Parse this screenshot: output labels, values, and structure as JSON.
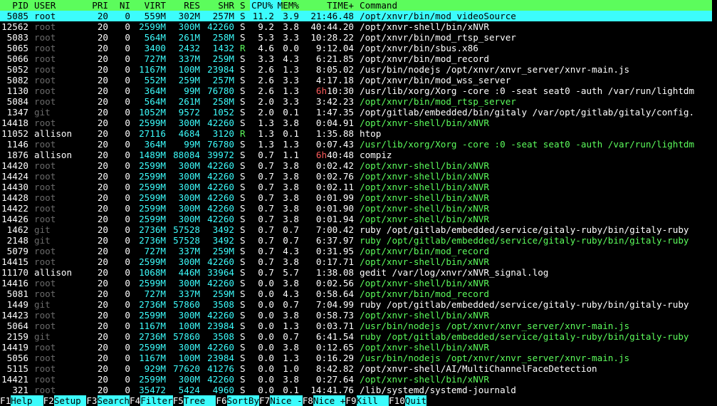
{
  "header": {
    "pid": "PID",
    "user": "USER",
    "pri": "PRI",
    "ni": "NI",
    "virt": "VIRT",
    "res": "RES",
    "shr": "SHR",
    "s": "S",
    "cpu": "CPU%",
    "mem": "MEM%",
    "time": "TIME+",
    "cmd": "Command"
  },
  "colors": {
    "header_bg": "#5cfc5c",
    "selected_bg": "#3cfcfc",
    "number": "#3cfcfc",
    "thread": "#5cfc5c",
    "hours": "#fc5c5c",
    "dim_user": "#6a6a6a"
  },
  "processes": [
    {
      "pid": "5085",
      "user": "root",
      "pri": "20",
      "ni": "0",
      "virt": "559M",
      "res": "302M",
      "shr": "257M",
      "s": "S",
      "cpu": "11.2",
      "mem": "3.9",
      "time": "21:46.48",
      "cmd": "/opt/xnvr/bin/mod_videoSource",
      "thread": false,
      "selected": true
    },
    {
      "pid": "12562",
      "user": "root",
      "pri": "20",
      "ni": "0",
      "virt": "2599M",
      "res": "300M",
      "shr": "42260",
      "s": "S",
      "cpu": "9.2",
      "mem": "3.8",
      "time": "40:44.20",
      "cmd": "/opt/xnvr-shell/bin/xNVR",
      "thread": false
    },
    {
      "pid": "5083",
      "user": "root",
      "pri": "20",
      "ni": "0",
      "virt": "564M",
      "res": "261M",
      "shr": "258M",
      "s": "S",
      "cpu": "5.3",
      "mem": "3.3",
      "time": "10:28.22",
      "cmd": "/opt/xnvr/bin/mod_rtsp_server",
      "thread": false
    },
    {
      "pid": "5065",
      "user": "root",
      "pri": "20",
      "ni": "0",
      "virt": "3400",
      "res": "2432",
      "shr": "1432",
      "s": "R",
      "cpu": "4.6",
      "mem": "0.0",
      "time": "9:12.04",
      "cmd": "/opt/xnvr/bin/sbus.x86",
      "thread": false
    },
    {
      "pid": "5066",
      "user": "root",
      "pri": "20",
      "ni": "0",
      "virt": "727M",
      "res": "337M",
      "shr": "259M",
      "s": "S",
      "cpu": "3.3",
      "mem": "4.3",
      "time": "6:21.85",
      "cmd": "/opt/xnvr/bin/mod_record",
      "thread": false
    },
    {
      "pid": "5052",
      "user": "root",
      "pri": "20",
      "ni": "0",
      "virt": "1167M",
      "res": "100M",
      "shr": "23984",
      "s": "S",
      "cpu": "2.6",
      "mem": "1.3",
      "time": "8:05.02",
      "cmd": "/usr/bin/nodejs /opt/xnvr/xnvr_server/xnvr-main.js",
      "thread": false
    },
    {
      "pid": "5082",
      "user": "root",
      "pri": "20",
      "ni": "0",
      "virt": "552M",
      "res": "259M",
      "shr": "257M",
      "s": "S",
      "cpu": "2.6",
      "mem": "3.3",
      "time": "4:17.18",
      "cmd": "/opt/xnvr/bin/mod_wss_server",
      "thread": false
    },
    {
      "pid": "1130",
      "user": "root",
      "pri": "20",
      "ni": "0",
      "virt": "364M",
      "res": "99M",
      "shr": "76780",
      "s": "S",
      "cpu": "2.6",
      "mem": "1.3",
      "time": "6h10:30",
      "cmd": "/usr/lib/xorg/Xorg -core :0 -seat seat0 -auth /var/run/lightdm",
      "thread": false
    },
    {
      "pid": "5084",
      "user": "root",
      "pri": "20",
      "ni": "0",
      "virt": "564M",
      "res": "261M",
      "shr": "258M",
      "s": "S",
      "cpu": "2.0",
      "mem": "3.3",
      "time": "3:42.23",
      "cmd": "/opt/xnvr/bin/mod_rtsp_server",
      "thread": true
    },
    {
      "pid": "1347",
      "user": "git",
      "pri": "20",
      "ni": "0",
      "virt": "1052M",
      "res": "9572",
      "shr": "1052",
      "s": "S",
      "cpu": "2.0",
      "mem": "0.1",
      "time": "1:47.35",
      "cmd": "/opt/gitlab/embedded/bin/gitaly /var/opt/gitlab/gitaly/config.",
      "thread": false
    },
    {
      "pid": "14418",
      "user": "root",
      "pri": "20",
      "ni": "0",
      "virt": "2599M",
      "res": "300M",
      "shr": "42260",
      "s": "S",
      "cpu": "1.3",
      "mem": "3.8",
      "time": "0:04.91",
      "cmd": "/opt/xnvr-shell/bin/xNVR",
      "thread": true
    },
    {
      "pid": "11052",
      "user": "allison",
      "pri": "20",
      "ni": "0",
      "virt": "27116",
      "res": "4684",
      "shr": "3120",
      "s": "R",
      "cpu": "1.3",
      "mem": "0.1",
      "time": "1:35.88",
      "cmd": "htop",
      "thread": false
    },
    {
      "pid": "1146",
      "user": "root",
      "pri": "20",
      "ni": "0",
      "virt": "364M",
      "res": "99M",
      "shr": "76780",
      "s": "S",
      "cpu": "1.3",
      "mem": "1.3",
      "time": "0:07.43",
      "cmd": "/usr/lib/xorg/Xorg -core :0 -seat seat0 -auth /var/run/lightdm",
      "thread": true
    },
    {
      "pid": "1876",
      "user": "allison",
      "pri": "20",
      "ni": "0",
      "virt": "1489M",
      "res": "88084",
      "shr": "39972",
      "s": "S",
      "cpu": "0.7",
      "mem": "1.1",
      "time": "6h40:48",
      "cmd": "compiz",
      "thread": false
    },
    {
      "pid": "14420",
      "user": "root",
      "pri": "20",
      "ni": "0",
      "virt": "2599M",
      "res": "300M",
      "shr": "42260",
      "s": "S",
      "cpu": "0.7",
      "mem": "3.8",
      "time": "0:02.42",
      "cmd": "/opt/xnvr-shell/bin/xNVR",
      "thread": true
    },
    {
      "pid": "14424",
      "user": "root",
      "pri": "20",
      "ni": "0",
      "virt": "2599M",
      "res": "300M",
      "shr": "42260",
      "s": "S",
      "cpu": "0.7",
      "mem": "3.8",
      "time": "0:02.76",
      "cmd": "/opt/xnvr-shell/bin/xNVR",
      "thread": true
    },
    {
      "pid": "14430",
      "user": "root",
      "pri": "20",
      "ni": "0",
      "virt": "2599M",
      "res": "300M",
      "shr": "42260",
      "s": "S",
      "cpu": "0.7",
      "mem": "3.8",
      "time": "0:02.11",
      "cmd": "/opt/xnvr-shell/bin/xNVR",
      "thread": true
    },
    {
      "pid": "14428",
      "user": "root",
      "pri": "20",
      "ni": "0",
      "virt": "2599M",
      "res": "300M",
      "shr": "42260",
      "s": "S",
      "cpu": "0.7",
      "mem": "3.8",
      "time": "0:01.99",
      "cmd": "/opt/xnvr-shell/bin/xNVR",
      "thread": true
    },
    {
      "pid": "14422",
      "user": "root",
      "pri": "20",
      "ni": "0",
      "virt": "2599M",
      "res": "300M",
      "shr": "42260",
      "s": "S",
      "cpu": "0.7",
      "mem": "3.8",
      "time": "0:01.90",
      "cmd": "/opt/xnvr-shell/bin/xNVR",
      "thread": true
    },
    {
      "pid": "14426",
      "user": "root",
      "pri": "20",
      "ni": "0",
      "virt": "2599M",
      "res": "300M",
      "shr": "42260",
      "s": "S",
      "cpu": "0.7",
      "mem": "3.8",
      "time": "0:01.94",
      "cmd": "/opt/xnvr-shell/bin/xNVR",
      "thread": true
    },
    {
      "pid": "1462",
      "user": "git",
      "pri": "20",
      "ni": "0",
      "virt": "2736M",
      "res": "57528",
      "shr": "3492",
      "s": "S",
      "cpu": "0.7",
      "mem": "0.7",
      "time": "7:00.42",
      "cmd": "ruby /opt/gitlab/embedded/service/gitaly-ruby/bin/gitaly-ruby",
      "thread": false
    },
    {
      "pid": "2148",
      "user": "git",
      "pri": "20",
      "ni": "0",
      "virt": "2736M",
      "res": "57528",
      "shr": "3492",
      "s": "S",
      "cpu": "0.7",
      "mem": "0.7",
      "time": "6:37.97",
      "cmd": "ruby /opt/gitlab/embedded/service/gitaly-ruby/bin/gitaly-ruby",
      "thread": true
    },
    {
      "pid": "5079",
      "user": "root",
      "pri": "20",
      "ni": "0",
      "virt": "727M",
      "res": "337M",
      "shr": "259M",
      "s": "S",
      "cpu": "0.7",
      "mem": "4.3",
      "time": "0:31.95",
      "cmd": "/opt/xnvr/bin/mod_record",
      "thread": true
    },
    {
      "pid": "14415",
      "user": "root",
      "pri": "20",
      "ni": "0",
      "virt": "2599M",
      "res": "300M",
      "shr": "42260",
      "s": "S",
      "cpu": "0.7",
      "mem": "3.8",
      "time": "0:17.71",
      "cmd": "/opt/xnvr-shell/bin/xNVR",
      "thread": true
    },
    {
      "pid": "11170",
      "user": "allison",
      "pri": "20",
      "ni": "0",
      "virt": "1068M",
      "res": "446M",
      "shr": "33964",
      "s": "S",
      "cpu": "0.7",
      "mem": "5.7",
      "time": "1:38.08",
      "cmd": "gedit /var/log/xnvr/xNVR_signal.log",
      "thread": false
    },
    {
      "pid": "14416",
      "user": "root",
      "pri": "20",
      "ni": "0",
      "virt": "2599M",
      "res": "300M",
      "shr": "42260",
      "s": "S",
      "cpu": "0.0",
      "mem": "3.8",
      "time": "0:02.56",
      "cmd": "/opt/xnvr-shell/bin/xNVR",
      "thread": true
    },
    {
      "pid": "5081",
      "user": "root",
      "pri": "20",
      "ni": "0",
      "virt": "727M",
      "res": "337M",
      "shr": "259M",
      "s": "S",
      "cpu": "0.0",
      "mem": "4.3",
      "time": "0:58.64",
      "cmd": "/opt/xnvr/bin/mod_record",
      "thread": true
    },
    {
      "pid": "1449",
      "user": "git",
      "pri": "20",
      "ni": "0",
      "virt": "2736M",
      "res": "57860",
      "shr": "3508",
      "s": "S",
      "cpu": "0.0",
      "mem": "0.7",
      "time": "7:04.99",
      "cmd": "ruby /opt/gitlab/embedded/service/gitaly-ruby/bin/gitaly-ruby",
      "thread": false
    },
    {
      "pid": "14423",
      "user": "root",
      "pri": "20",
      "ni": "0",
      "virt": "2599M",
      "res": "300M",
      "shr": "42260",
      "s": "S",
      "cpu": "0.0",
      "mem": "3.8",
      "time": "0:58.73",
      "cmd": "/opt/xnvr-shell/bin/xNVR",
      "thread": true
    },
    {
      "pid": "5064",
      "user": "root",
      "pri": "20",
      "ni": "0",
      "virt": "1167M",
      "res": "100M",
      "shr": "23984",
      "s": "S",
      "cpu": "0.0",
      "mem": "1.3",
      "time": "0:03.71",
      "cmd": "/usr/bin/nodejs /opt/xnvr/xnvr_server/xnvr-main.js",
      "thread": true
    },
    {
      "pid": "2159",
      "user": "git",
      "pri": "20",
      "ni": "0",
      "virt": "2736M",
      "res": "57860",
      "shr": "3508",
      "s": "S",
      "cpu": "0.0",
      "mem": "0.7",
      "time": "6:41.54",
      "cmd": "ruby /opt/gitlab/embedded/service/gitaly-ruby/bin/gitaly-ruby",
      "thread": true
    },
    {
      "pid": "14419",
      "user": "root",
      "pri": "20",
      "ni": "0",
      "virt": "2599M",
      "res": "300M",
      "shr": "42260",
      "s": "S",
      "cpu": "0.0",
      "mem": "3.8",
      "time": "0:12.65",
      "cmd": "/opt/xnvr-shell/bin/xNVR",
      "thread": true
    },
    {
      "pid": "5056",
      "user": "root",
      "pri": "20",
      "ni": "0",
      "virt": "1167M",
      "res": "100M",
      "shr": "23984",
      "s": "S",
      "cpu": "0.0",
      "mem": "1.3",
      "time": "0:16.29",
      "cmd": "/usr/bin/nodejs /opt/xnvr/xnvr_server/xnvr-main.js",
      "thread": true
    },
    {
      "pid": "5115",
      "user": "root",
      "pri": "20",
      "ni": "0",
      "virt": "929M",
      "res": "77620",
      "shr": "41276",
      "s": "S",
      "cpu": "0.0",
      "mem": "1.0",
      "time": "8:42.82",
      "cmd": "/opt/xnvr-shell/AI/MultiChannelFaceDetection",
      "thread": false
    },
    {
      "pid": "14421",
      "user": "root",
      "pri": "20",
      "ni": "0",
      "virt": "2599M",
      "res": "300M",
      "shr": "42260",
      "s": "S",
      "cpu": "0.0",
      "mem": "3.8",
      "time": "0:27.64",
      "cmd": "/opt/xnvr-shell/bin/xNVR",
      "thread": true
    },
    {
      "pid": "321",
      "user": "root",
      "pri": "20",
      "ni": "0",
      "virt": "35472",
      "res": "5424",
      "shr": "4960",
      "s": "S",
      "cpu": "0.0",
      "mem": "0.1",
      "time": "14:41.76",
      "cmd": "/lib/systemd/systemd-journald",
      "thread": false
    }
  ],
  "footer": [
    {
      "key": "F1",
      "label": "Help  "
    },
    {
      "key": "F2",
      "label": "Setup "
    },
    {
      "key": "F3",
      "label": "Search"
    },
    {
      "key": "F4",
      "label": "Filter"
    },
    {
      "key": "F5",
      "label": "Tree  "
    },
    {
      "key": "F6",
      "label": "SortBy"
    },
    {
      "key": "F7",
      "label": "Nice -"
    },
    {
      "key": "F8",
      "label": "Nice +"
    },
    {
      "key": "F9",
      "label": "Kill  "
    },
    {
      "key": "F10",
      "label": "Quit"
    }
  ]
}
